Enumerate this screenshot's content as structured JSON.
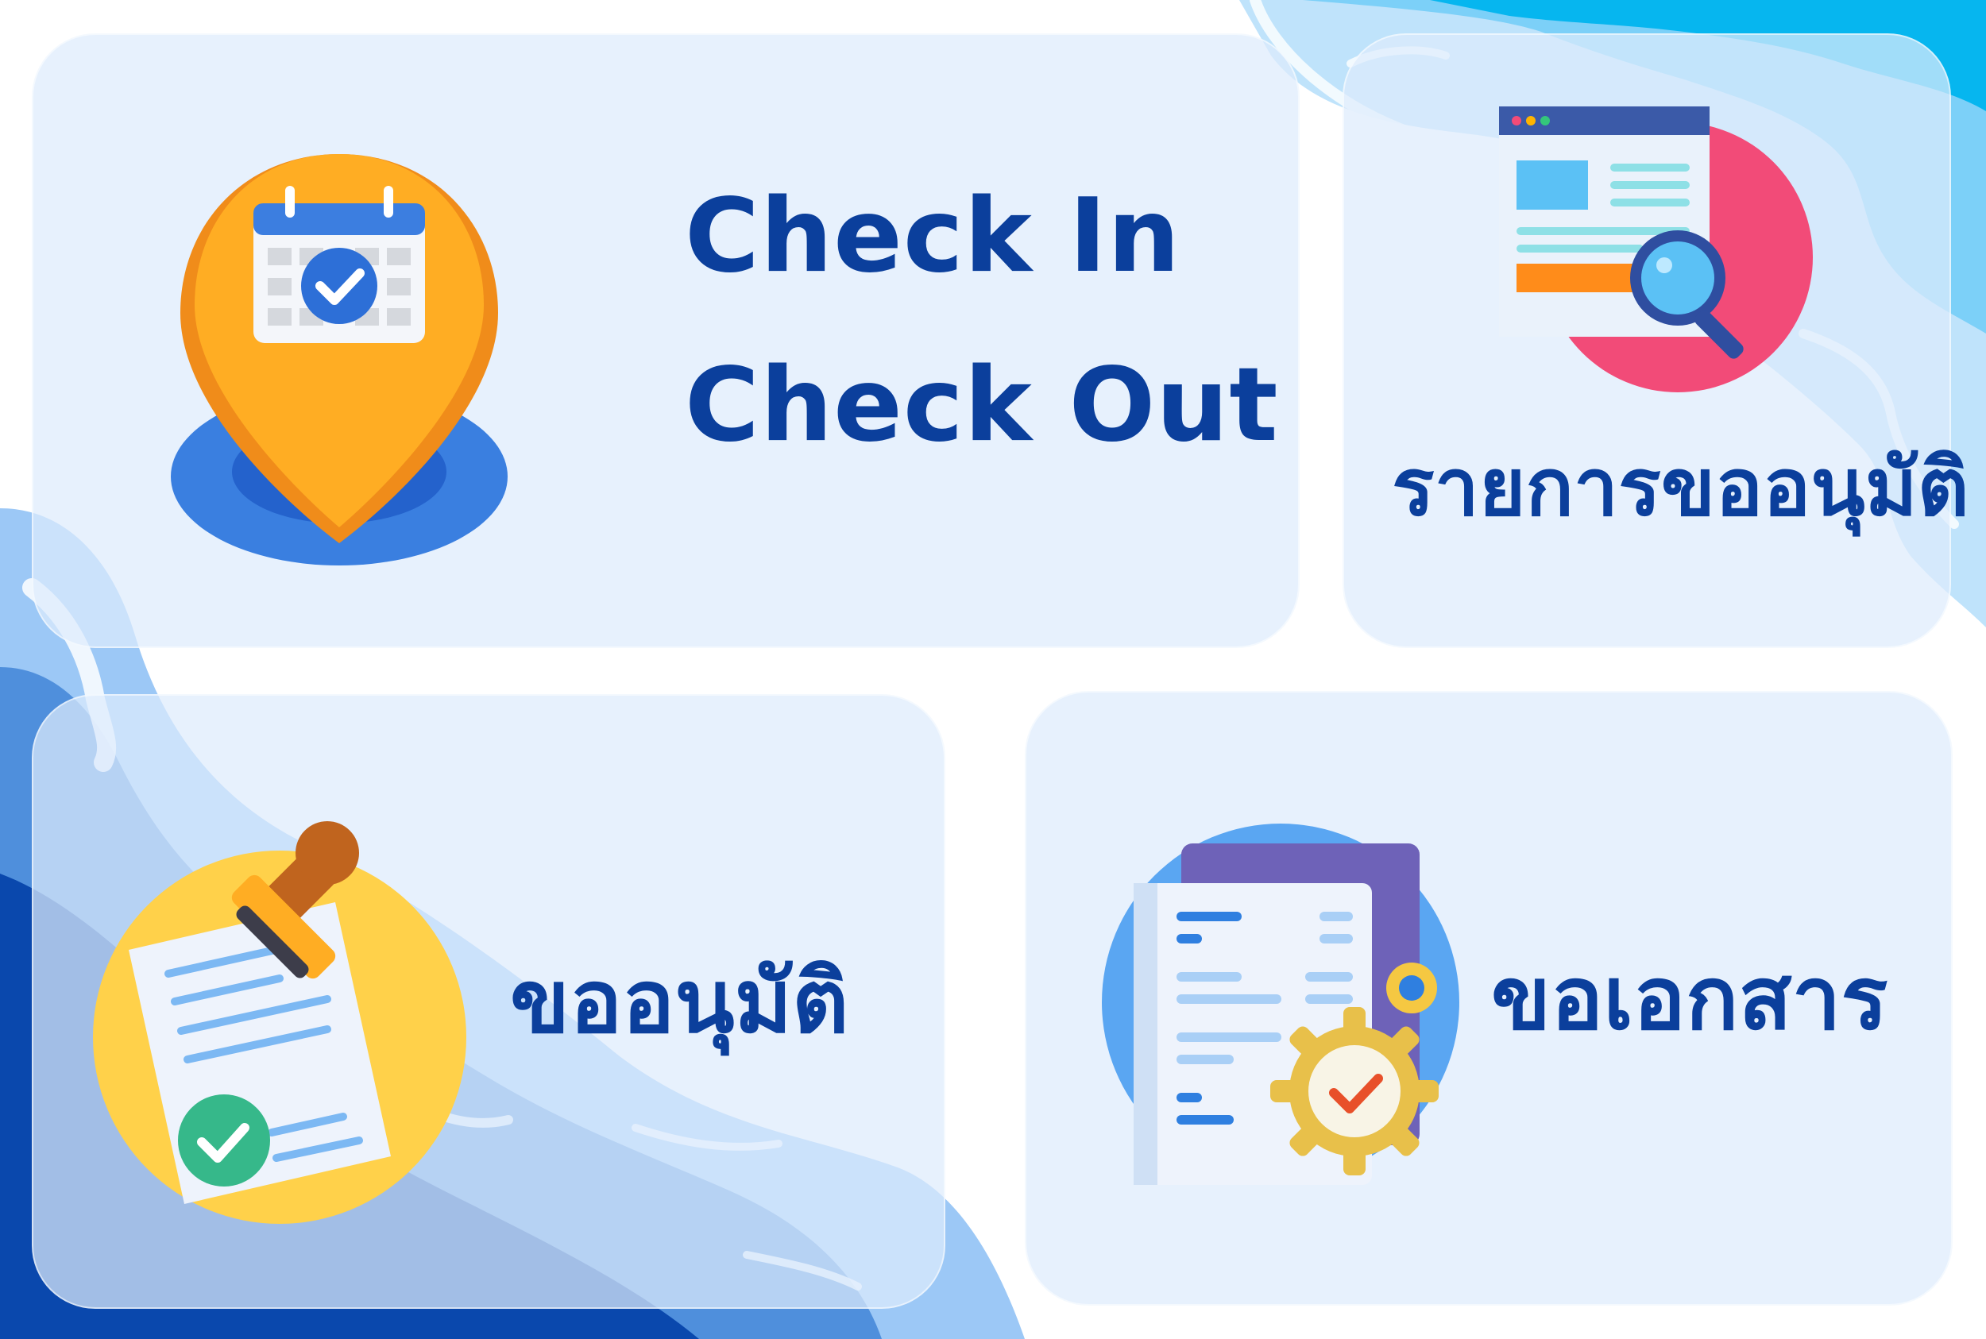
{
  "tiles": {
    "checkin": {
      "line1": "Check In",
      "line2": "Check Out",
      "icon": "calendar-location-pin-icon"
    },
    "approval_list": {
      "label": "รายการขออนุมัติ",
      "icon": "document-search-icon"
    },
    "request_approval": {
      "label": "ขออนุมัติ",
      "icon": "document-stamp-approve-icon"
    },
    "request_documents": {
      "label": "ขอเอกสาร",
      "icon": "document-gear-icon"
    }
  },
  "colors": {
    "label_text": "#0b3f9c",
    "tile_background": "#deecfc",
    "wave_dark": "#0a48ad",
    "wave_light": "#9cc8f6",
    "accent_cyan": "#06b6ef"
  }
}
